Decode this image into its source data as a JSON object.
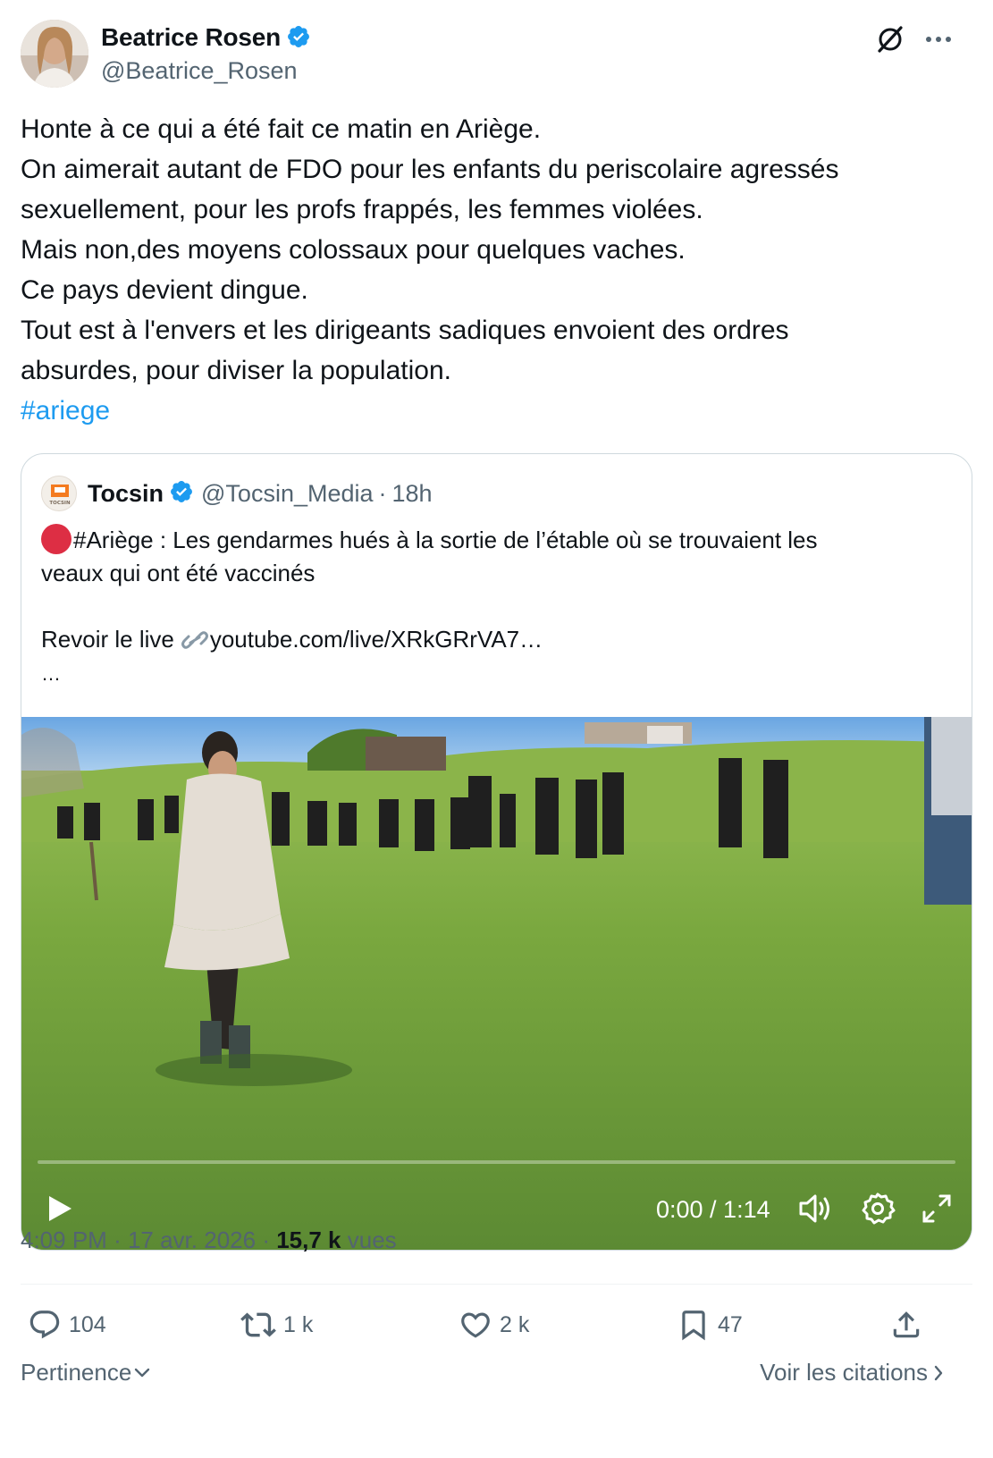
{
  "author": {
    "name": "Beatrice Rosen",
    "handle": "@Beatrice_Rosen",
    "verified": true
  },
  "tweet": {
    "lines": [
      "Honte à ce qui a été fait ce matin en Ariège.",
      "On aimerait autant de FDO pour les enfants du periscolaire agressés",
      "sexuellement, pour les profs frappés, les femmes violées.",
      "Mais non,des moyens colossaux pour quelques vaches.",
      "Ce pays devient dingue.",
      "Tout est à l'envers et les dirigeants sadiques envoient des ordres",
      "absurdes, pour diviser la population."
    ],
    "hashtag": "#ariege"
  },
  "quote": {
    "name": "Tocsin",
    "handle": "@Tocsin_Media",
    "time": "18h",
    "line1": "#Ariège : Les gendarmes hués à la sortie de l’étable où se trouvaient les",
    "line2": "veaux qui ont été vaccinés",
    "live_prefix": "Revoir le live",
    "link": "youtube.com/live/XRkGRrVA7…",
    "ellipsis": "…",
    "avatar_text": "TOCSIN"
  },
  "video": {
    "time": "0:00 / 1:14",
    "progress": 0
  },
  "meta": {
    "time": "4:09 PM",
    "date": "17 avr. 2026",
    "views_count": "15,7 k",
    "views_label": "vues"
  },
  "actions": {
    "replies": "104",
    "reposts": "1 k",
    "likes": "2 k",
    "bookmarks": "47"
  },
  "footer": {
    "sort": "Pertinence",
    "quotes": "Voir les citations"
  },
  "colors": {
    "accent": "#1d9bf0",
    "secondary_text": "#536471",
    "primary_text": "#0f1419",
    "live_dot": "#dd2e44"
  }
}
